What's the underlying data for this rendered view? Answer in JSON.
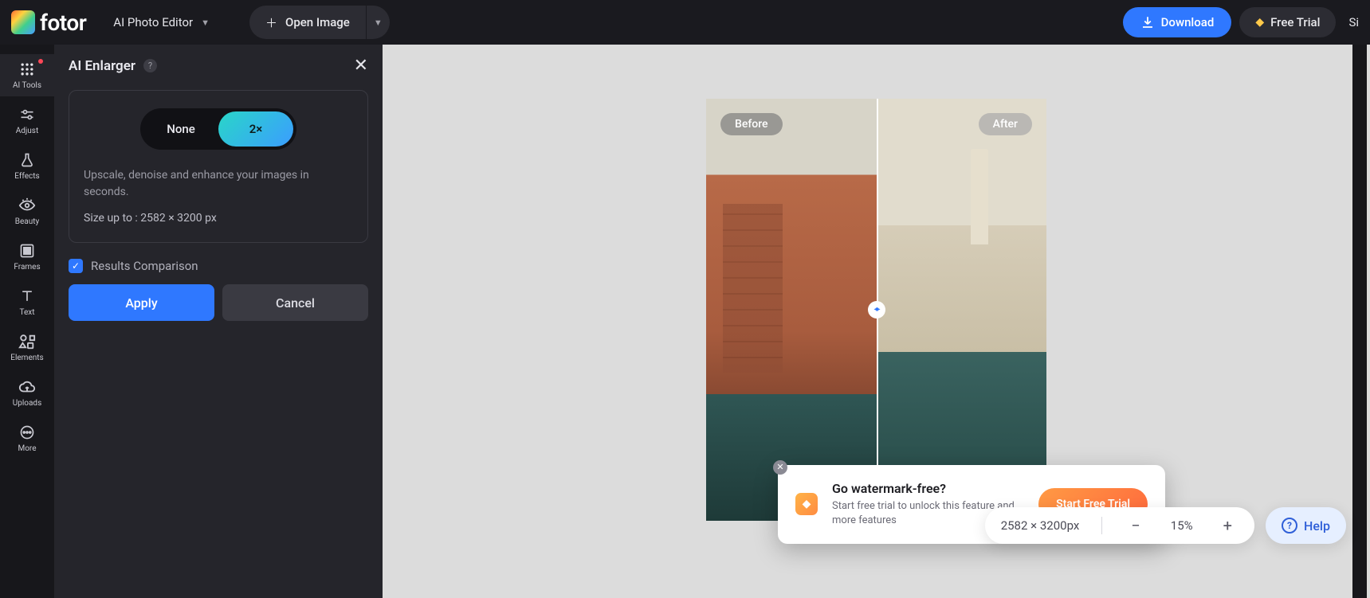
{
  "header": {
    "logo_text": "fotor",
    "mode_label": "AI Photo Editor",
    "open_image_label": "Open Image",
    "download_label": "Download",
    "free_trial_label": "Free Trial",
    "signin_partial": "Si"
  },
  "leftnav": {
    "items": [
      {
        "label": "AI Tools"
      },
      {
        "label": "Adjust"
      },
      {
        "label": "Effects"
      },
      {
        "label": "Beauty"
      },
      {
        "label": "Frames"
      },
      {
        "label": "Text"
      },
      {
        "label": "Elements"
      },
      {
        "label": "Uploads"
      },
      {
        "label": "More"
      }
    ]
  },
  "panel": {
    "title": "AI Enlarger",
    "toggle_none": "None",
    "toggle_2x": "2×",
    "description": "Upscale, denoise and enhance your images in seconds.",
    "size_line": "Size up to : 2582 × 3200 px",
    "results_comparison_label": "Results Comparison",
    "apply_label": "Apply",
    "cancel_label": "Cancel"
  },
  "canvas": {
    "before_label": "Before",
    "after_label": "After"
  },
  "promo": {
    "title": "Go watermark-free?",
    "subtitle": "Start free trial to unlock this feature and more features",
    "cta": "Start Free Trial"
  },
  "bottombar": {
    "size_text": "2582 × 3200px",
    "zoom_pct": "15%",
    "help_label": "Help"
  }
}
